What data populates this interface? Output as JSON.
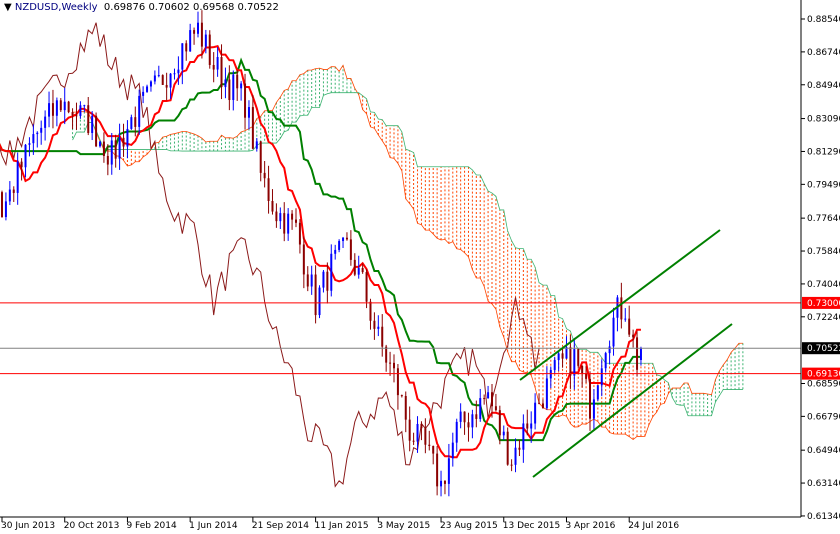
{
  "header": {
    "symbol_timeframe": "NZDUSD,Weekly",
    "ohlc": "0.69876 0.70602 0.69568 0.70522"
  },
  "colors": {
    "bull": "#0000ff",
    "bear": "#8b0000",
    "tenkan": "#ff0000",
    "kijun": "#008000",
    "chikou": "#8b1a1a",
    "cloud_up": "#3cb371",
    "cloud_down": "#ff4500",
    "hline": "#ff0000",
    "bid": "#808080",
    "channel": "#008000"
  },
  "chart_data": {
    "type": "candlestick",
    "title": "NZDUSD,Weekly",
    "indicators": [
      "Ichimoku Kinko Hyo (9,26,52)"
    ],
    "ylim": [
      0.6134,
      0.8854
    ],
    "y_ticks": [
      "0.88540",
      "0.86740",
      "0.84940",
      "0.83090",
      "0.81290",
      "0.79490",
      "0.77640",
      "0.75840",
      "0.74040",
      "0.72240",
      "0.68590",
      "0.66790",
      "0.64940",
      "0.63140",
      "0.61340"
    ],
    "y_tick_values": [
      0.8854,
      0.8674,
      0.8494,
      0.8309,
      0.8129,
      0.7949,
      0.7764,
      0.7584,
      0.7404,
      0.7224,
      0.6859,
      0.6679,
      0.6494,
      0.6314,
      0.6134
    ],
    "x_ticks": [
      "30 Jun 2013",
      "20 Oct 2013",
      "9 Feb 2014",
      "1 Jun 2014",
      "21 Sep 2014",
      "11 Jan 2015",
      "3 May 2015",
      "23 Aug 2015",
      "13 Dec 2015",
      "3 Apr 2016",
      "24 Jul 2016"
    ],
    "x_tick_weeks": [
      0,
      16,
      32,
      48,
      64,
      80,
      96,
      112,
      128,
      144,
      160
    ],
    "price_path_weeks": [
      -60,
      -40,
      -20,
      -5,
      0,
      8,
      15,
      22,
      28,
      33,
      40,
      46,
      50,
      54,
      58,
      62,
      66,
      70,
      75,
      80,
      84,
      88,
      92,
      96,
      100,
      104,
      108,
      110,
      112,
      116,
      120,
      124,
      127,
      130,
      134,
      138,
      142,
      146,
      150,
      154,
      157,
      159,
      162,
      163
    ],
    "price_path_values": [
      0.8,
      0.84,
      0.83,
      0.84,
      0.78,
      0.82,
      0.84,
      0.83,
      0.81,
      0.83,
      0.85,
      0.87,
      0.88,
      0.86,
      0.85,
      0.84,
      0.8,
      0.78,
      0.77,
      0.73,
      0.75,
      0.76,
      0.74,
      0.71,
      0.69,
      0.66,
      0.65,
      0.64,
      0.63,
      0.66,
      0.67,
      0.68,
      0.66,
      0.645,
      0.665,
      0.68,
      0.695,
      0.7,
      0.675,
      0.71,
      0.725,
      0.728,
      0.698,
      0.705
    ],
    "horizontal_levels": [
      {
        "label": "0.73000",
        "value": 0.73
      },
      {
        "label": "0.70522",
        "value": 0.70522
      },
      {
        "label": "0.69130",
        "value": 0.6913
      }
    ]
  }
}
